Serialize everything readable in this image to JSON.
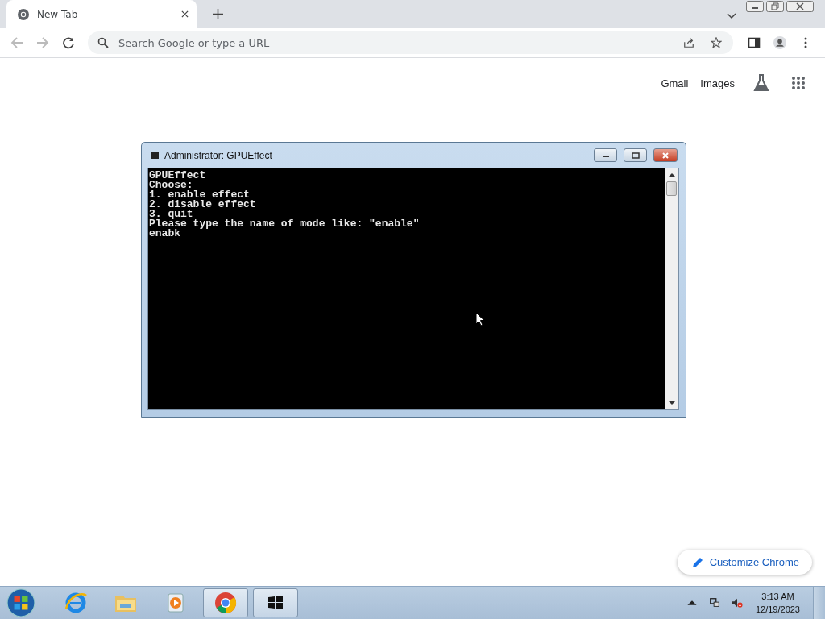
{
  "browser": {
    "tab": {
      "title": "New Tab"
    },
    "omnibox": {
      "placeholder": "Search Google or type a URL"
    },
    "links": [
      "Gmail",
      "Images"
    ],
    "customize_button": "Customize Chrome"
  },
  "console": {
    "title": "Administrator:  GPUEffect",
    "lines": [
      "GPUEffect",
      "Choose:",
      "1. enable effect",
      "2. disable effect",
      "3. quit",
      "Please type the name of mode like: \"enable\""
    ],
    "input": "enabk"
  },
  "taskbar": {
    "apps": [
      {
        "kind": "ie",
        "selected": false
      },
      {
        "kind": "folder",
        "selected": false
      },
      {
        "kind": "media",
        "selected": false
      },
      {
        "kind": "chrome",
        "selected": true
      },
      {
        "kind": "console",
        "selected": true
      }
    ],
    "time": "3:13 AM",
    "date": "12/19/2023"
  }
}
